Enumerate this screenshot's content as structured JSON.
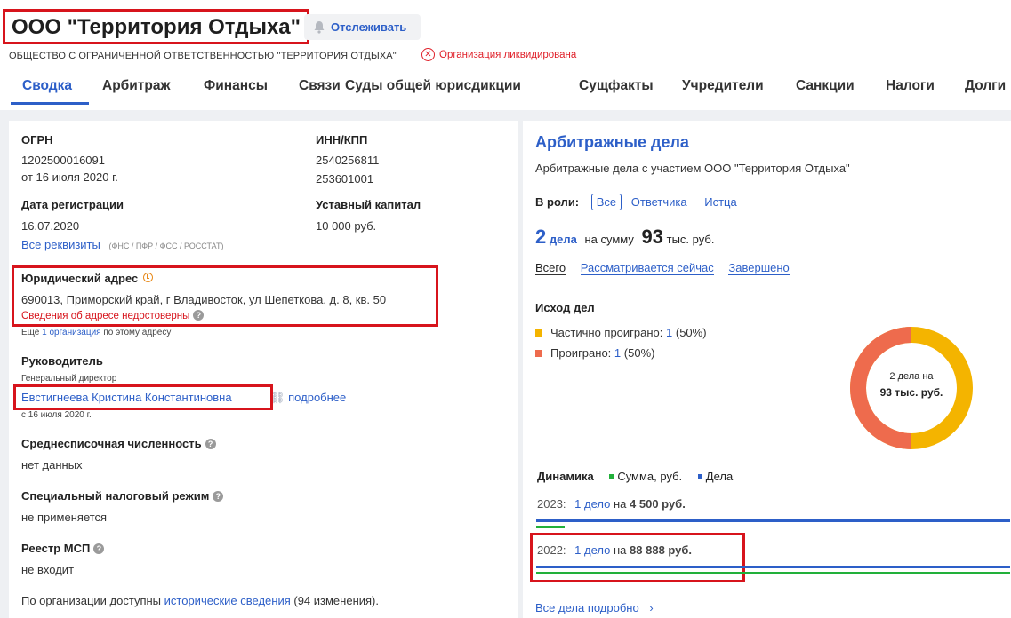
{
  "header": {
    "title": "ООО \"Территория Отдыха\"",
    "follow_label": "Отслеживать",
    "full_name": "ОБЩЕСТВО С ОГРАНИЧЕННОЙ ОТВЕТСТВЕННОСТЬЮ \"ТЕРРИТОРИЯ ОТДЫХА\"",
    "status": "Организация ликвидирована",
    "status_icon": "x-circle-icon",
    "follow_icon": "bell-icon"
  },
  "tabs": [
    "Сводка",
    "Арбитраж",
    "Финансы",
    "Связи",
    "Суды общей юрисдикции",
    "Сущфакты",
    "Учредители",
    "Санкции",
    "Налоги",
    "Долги"
  ],
  "active_tab": "Сводка",
  "details": {
    "ogrn_label": "ОГРН",
    "ogrn": "1202500016091",
    "ogrn_date": "от 16 июля 2020 г.",
    "inn_label": "ИНН/КПП",
    "inn": "2540256811",
    "kpp": "253601001",
    "reg_date_label": "Дата регистрации",
    "reg_date": "16.07.2020",
    "capital_label": "Уставный капитал",
    "capital": "10 000 руб.",
    "all_details_link": "Все реквизиты",
    "all_details_sources": "(ФНС / ПФР / ФСС / РОССТАТ)",
    "address_label": "Юридический адрес",
    "address": "690013, Приморский край, г Владивосток, ул Шепеткова, д. 8, кв. 50",
    "address_warning": "Сведения об адресе недостоверны",
    "more_orgs_prefix": "Еще",
    "more_orgs_count": "1",
    "more_orgs_link": "организация",
    "more_orgs_suffix": "по этому адресу",
    "head_label": "Руководитель",
    "head_position": "Генеральный директор",
    "head_name": "Евстигнеева Кристина Константиновна",
    "head_more": "подробнее",
    "head_since": "с 16 июля 2020 г.",
    "staff_label": "Среднесписочная численность",
    "staff_value": "нет данных",
    "tax_label": "Специальный налоговый режим",
    "tax_value": "не применяется",
    "msp_label": "Реестр МСП",
    "msp_value": "не входит",
    "history_prefix": "По организации доступны",
    "history_link": "исторические сведения",
    "history_suffix": "(94 изменения)."
  },
  "arbitration": {
    "title": "Арбитражные дела",
    "subtitle": "Арбитражные дела с участием ООО \"Территория Отдыха\"",
    "role_label": "В роли:",
    "roles": [
      "Все",
      "Ответчика",
      "Истца"
    ],
    "count": "2",
    "count_unit": "дела",
    "sum_label": "на сумму",
    "sum_value": "93",
    "sum_unit": "тыс. руб.",
    "filters": [
      "Всего",
      "Рассматривается сейчас",
      "Завершено"
    ],
    "outcome_title": "Исход дел",
    "outcomes": [
      {
        "label": "Частично проиграно:",
        "count": "1",
        "pct": "(50%)",
        "color": "#f4b400"
      },
      {
        "label": "Проиграно:",
        "count": "1",
        "pct": "(50%)",
        "color": "#ee6b4d"
      }
    ],
    "donut_line1": "2 дела на",
    "donut_line2": "93 тыс. руб.",
    "dynamics_title": "Динамика",
    "legend_sum": "Сумма, руб.",
    "legend_cases": "Дела",
    "sum_color": "#22b03a",
    "cases_color": "#2d5fc8",
    "years": [
      {
        "year": "2023:",
        "cases_link": "1 дело",
        "on": "на",
        "amount": "4 500 руб.",
        "cases_fraction": 1.0,
        "sum_fraction": 0.06
      },
      {
        "year": "2022:",
        "cases_link": "1 дело",
        "on": "на",
        "amount": "88 888 руб.",
        "cases_fraction": 1.0,
        "sum_fraction": 1.0
      }
    ],
    "all_link": "Все дела подробно"
  }
}
